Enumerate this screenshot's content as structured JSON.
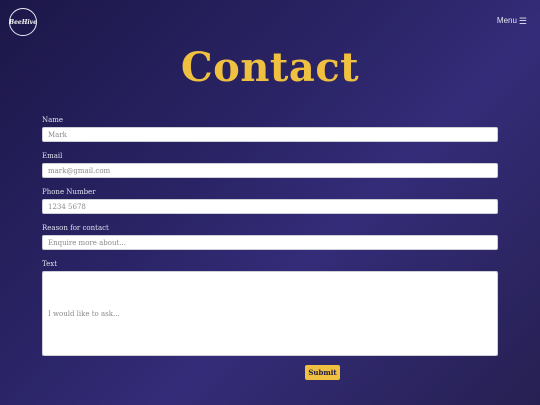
{
  "header": {
    "logo_text": "BeeHive",
    "menu_label": "Menu",
    "menu_icon": "hamburger-icon"
  },
  "page": {
    "title": "Contact"
  },
  "form": {
    "name_label": "Name",
    "name_placeholder": "Mark",
    "email_label": "Email",
    "email_placeholder": "mark@gmail.com",
    "phone_label": "Phone Number",
    "phone_placeholder": "1234 5678",
    "reason_label": "Reason for contact",
    "reason_placeholder": "Enquire more about...",
    "text_label": "Text",
    "text_placeholder": "I would like to ask...",
    "submit_label": "Submit"
  },
  "colors": {
    "accent": "#f0c040",
    "background": "#2a2466"
  }
}
